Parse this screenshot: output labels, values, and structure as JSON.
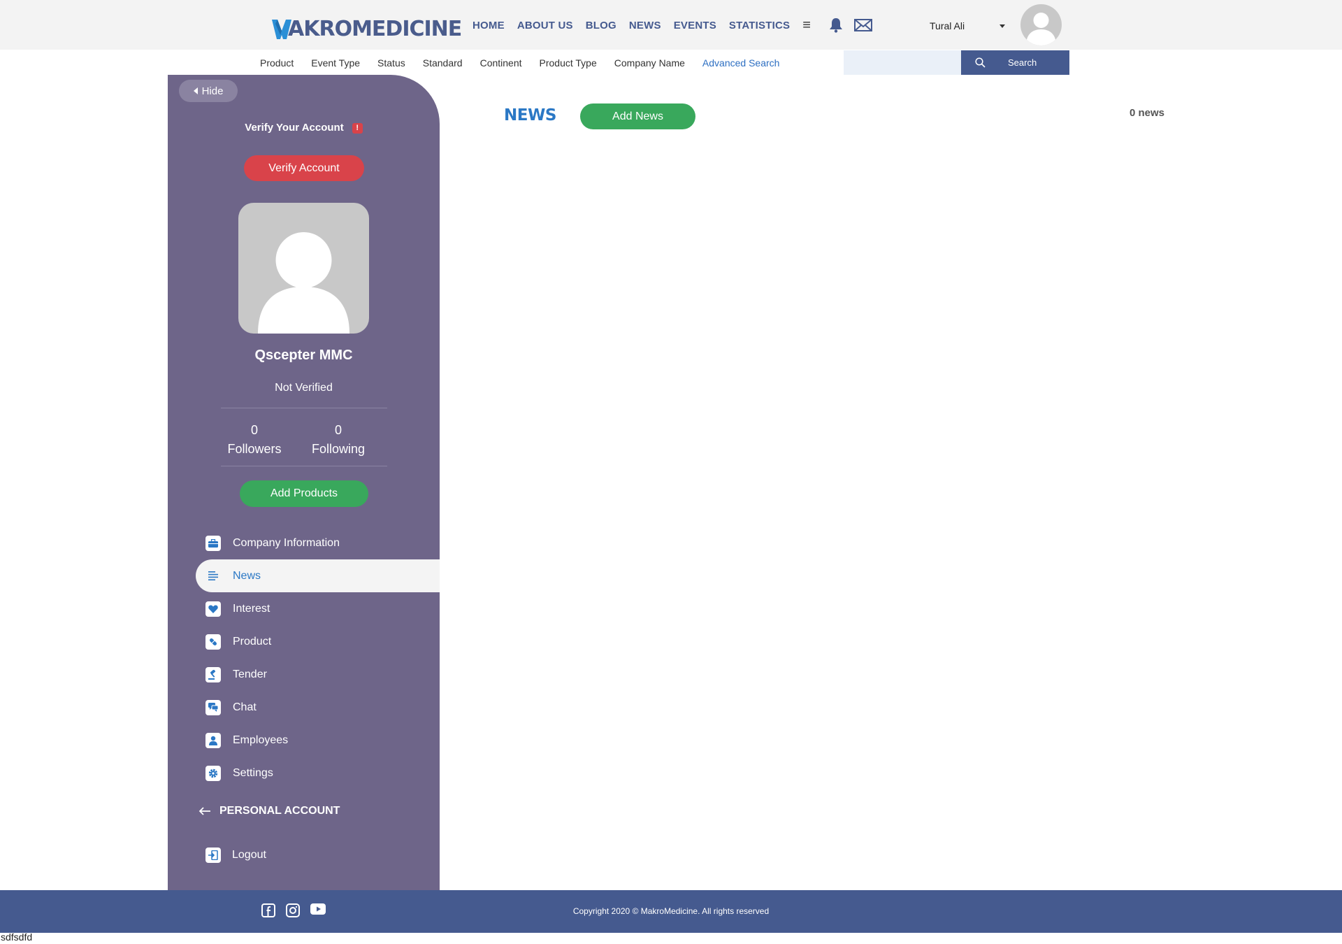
{
  "brand": {
    "logo_text": "AKROMEDICINE",
    "logo_full": "MAKROMEDICINE"
  },
  "nav": {
    "items": [
      "HOME",
      "ABOUT US",
      "BLOG",
      "NEWS",
      "EVENTS",
      "STATISTICS"
    ],
    "menu_icon": "hamburger-icon",
    "notification_icon": "bell-icon",
    "message_icon": "envelope-icon"
  },
  "user": {
    "name": "Tural Ali"
  },
  "filters": {
    "items": [
      "Product",
      "Event Type",
      "Status",
      "Standard",
      "Continent",
      "Product Type",
      "Company Name"
    ],
    "advanced": "Advanced Search"
  },
  "search": {
    "value": "",
    "button_label": "Search"
  },
  "sidebar": {
    "hide_label": "Hide",
    "verify_title": "Verify Your Account",
    "warning_mark": "!",
    "verify_button": "Verify Account",
    "company_name": "Qscepter MMC",
    "status": "Not Verified",
    "followers_count": "0",
    "followers_label": "Followers",
    "following_count": "0",
    "following_label": "Following",
    "add_products": "Add Products",
    "menu": [
      {
        "label": "Company Information",
        "icon": "briefcase-icon"
      },
      {
        "label": "News",
        "icon": "news-lines-icon",
        "active": true
      },
      {
        "label": "Interest",
        "icon": "heart-icon"
      },
      {
        "label": "Product",
        "icon": "pill-icon"
      },
      {
        "label": "Tender",
        "icon": "gavel-icon"
      },
      {
        "label": "Chat",
        "icon": "chat-icon"
      },
      {
        "label": "Employees",
        "icon": "person-icon"
      },
      {
        "label": "Settings",
        "icon": "gear-icon"
      }
    ],
    "personal_account": "PERSONAL ACCOUNT",
    "logout": "Logout"
  },
  "main": {
    "title": "NEWS",
    "add_news": "Add News",
    "count_text": "0 news"
  },
  "footer": {
    "copyright": "Copyright 2020 © MakroMedicine. All rights reserved",
    "social_icons": [
      "facebook-icon",
      "instagram-icon",
      "youtube-icon"
    ]
  },
  "stray_text": "sdfsdfd",
  "colors": {
    "sidebar": "#6e6589",
    "brand_blue": "#455a8f",
    "accent_blue": "#2b78c5",
    "green": "#39a85c",
    "red": "#d9434a"
  }
}
